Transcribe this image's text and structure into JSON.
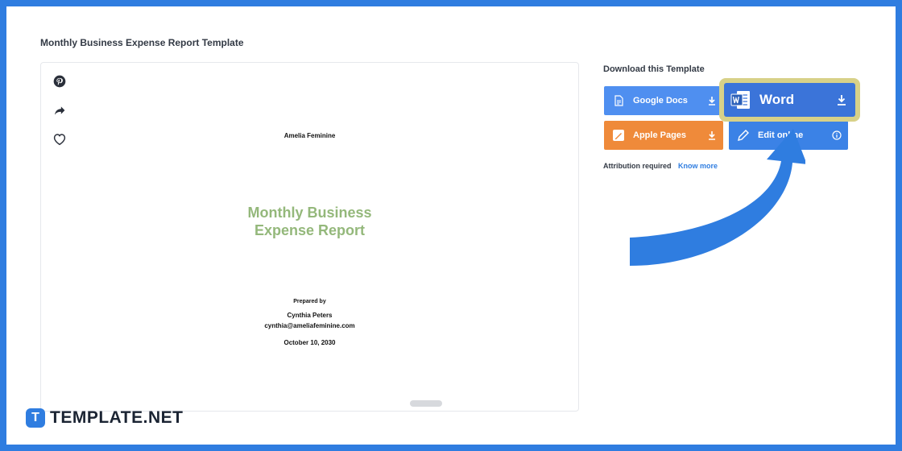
{
  "page": {
    "title": "Monthly Business Expense Report Template"
  },
  "share_icons": [
    "pinterest-icon",
    "share-icon",
    "heart-icon"
  ],
  "document": {
    "author": "Amelia Feminine",
    "title_line1": "Monthly Business",
    "title_line2": "Expense Report",
    "prepared_by_label": "Prepared by",
    "name": "Cynthia Peters",
    "email": "cynthia@ameliafeminine.com",
    "date": "October 10, 2030",
    "title_color": "#94b87b"
  },
  "download": {
    "title": "Download this Template",
    "buttons": {
      "google_docs": "Google Docs",
      "word": "Word",
      "apple_pages": "Apple Pages",
      "edit_online": "Edit online"
    },
    "colors": {
      "google_docs": "#4f8ff0",
      "word": "#3b74d9",
      "apple_pages": "#ef8a3a",
      "edit_online": "#3b82e6",
      "highlight": "#d8d188"
    }
  },
  "attribution": {
    "label": "Attribution required",
    "link": "Know more"
  },
  "brand": {
    "logo_letter": "T",
    "name": "TEMPLATE.NET",
    "color": "#2f7de0"
  }
}
